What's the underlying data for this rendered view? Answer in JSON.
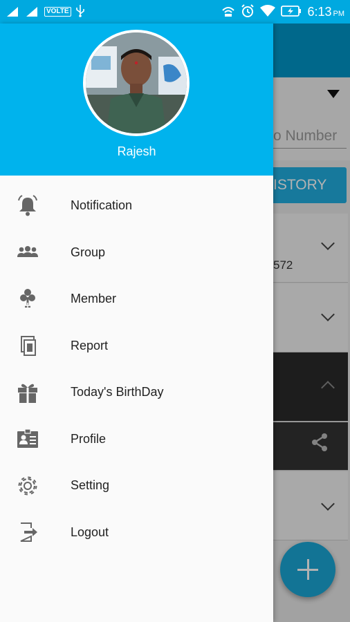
{
  "status_bar": {
    "volte": "VOLTE",
    "time": "6:13",
    "ampm": "PM",
    "accent": "#00a9e0"
  },
  "background_app": {
    "number_placeholder": "o Number",
    "history_button": "ISTORY",
    "phone_fragment": "572"
  },
  "drawer": {
    "header_color": "#00b3ed",
    "user_name": "Rajesh",
    "items": [
      {
        "label": "Notification",
        "icon": "bell-icon"
      },
      {
        "label": "Group",
        "icon": "group-icon"
      },
      {
        "label": "Member",
        "icon": "member-icon"
      },
      {
        "label": "Report",
        "icon": "report-icon"
      },
      {
        "label": "Today's BirthDay",
        "icon": "gift-icon"
      },
      {
        "label": "Profile",
        "icon": "profile-card-icon"
      },
      {
        "label": "Setting",
        "icon": "gear-icon"
      },
      {
        "label": "Logout",
        "icon": "logout-icon"
      }
    ]
  }
}
